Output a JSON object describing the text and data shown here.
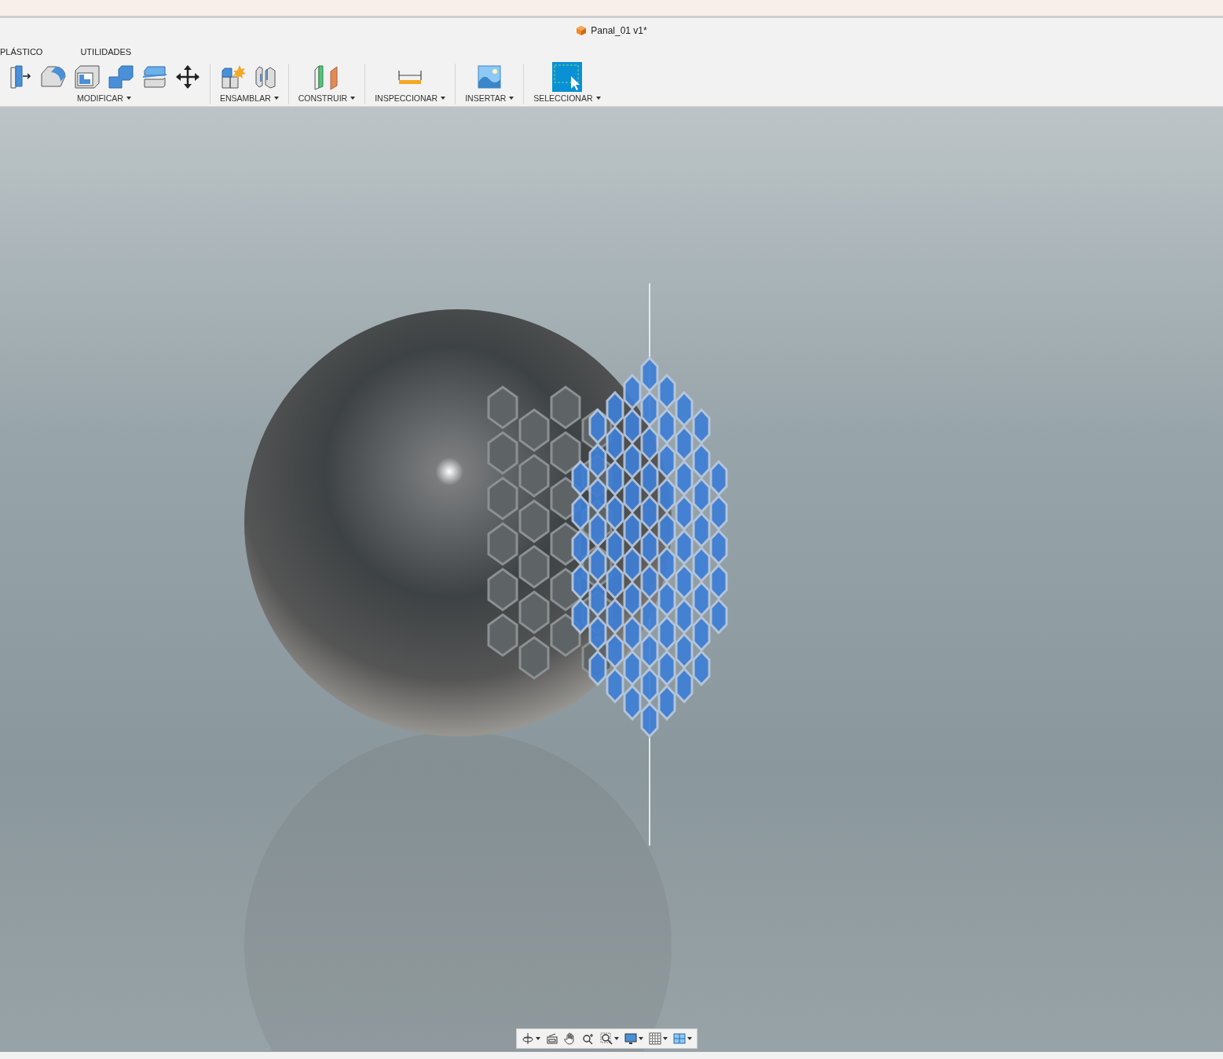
{
  "window": {
    "title": "Panal_01 v1*"
  },
  "tabs": [
    "PLÁSTICO",
    "UTILIDADES"
  ],
  "groups": [
    {
      "kind": "modify",
      "label": "MODIFICAR",
      "has_menu": true
    },
    {
      "kind": "assemble",
      "label": "ENSAMBLAR",
      "has_menu": true
    },
    {
      "kind": "construct",
      "label": "CONSTRUIR",
      "has_menu": true
    },
    {
      "kind": "inspect",
      "label": "INSPECCIONAR",
      "has_menu": true
    },
    {
      "kind": "insert",
      "label": "INSERTAR",
      "has_menu": true
    },
    {
      "kind": "select",
      "label": "SELECCIONAR",
      "has_menu": true
    }
  ],
  "nav_bar": [
    {
      "kind": "orbit",
      "has_menu": true
    },
    {
      "kind": "look-at",
      "has_menu": false
    },
    {
      "kind": "pan",
      "has_menu": false
    },
    {
      "kind": "zoom",
      "has_menu": false
    },
    {
      "kind": "fit",
      "has_menu": true
    },
    {
      "kind": "display",
      "has_menu": true
    },
    {
      "kind": "grid",
      "has_menu": true
    },
    {
      "kind": "viewports",
      "has_menu": true
    }
  ]
}
